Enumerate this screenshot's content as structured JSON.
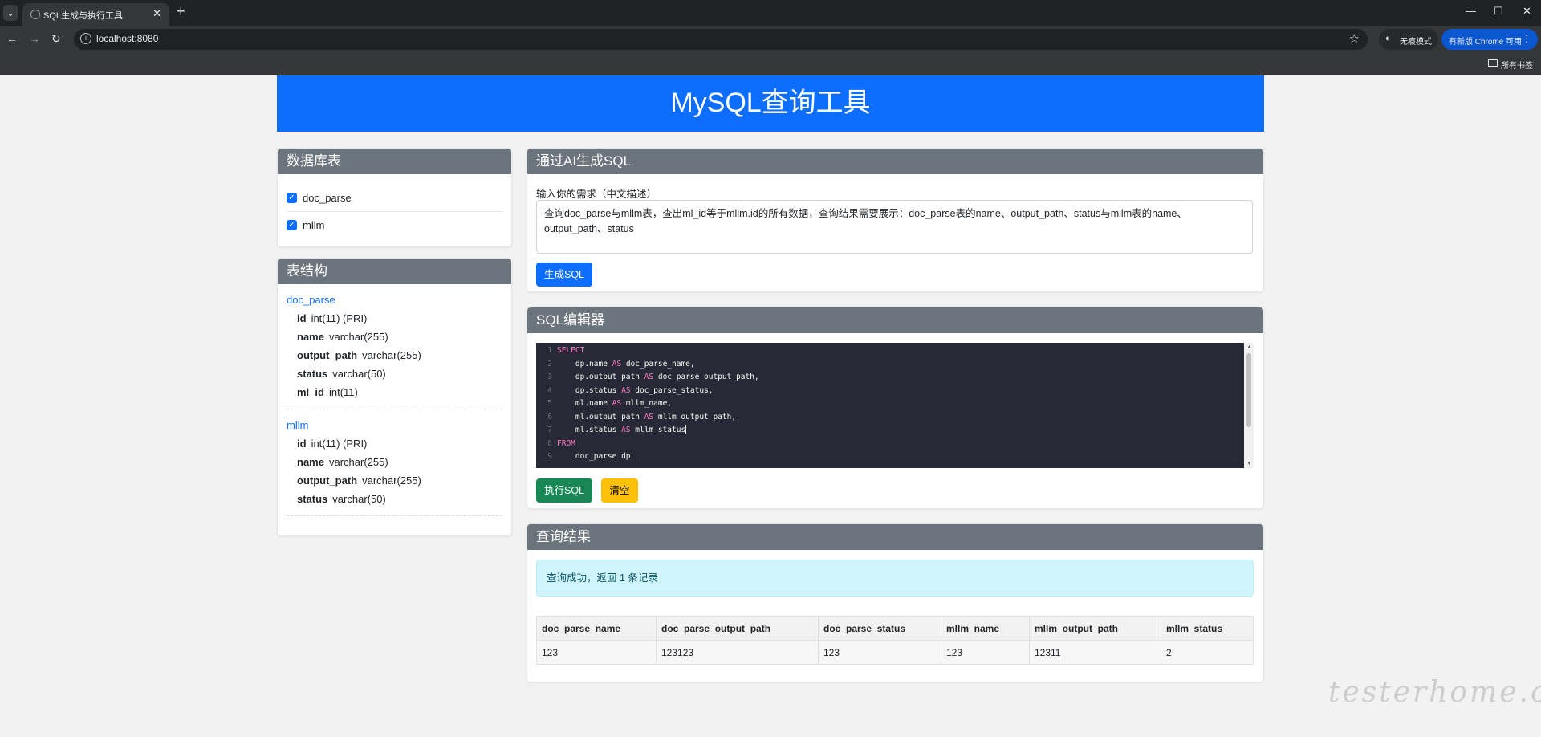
{
  "browser": {
    "tab_title": "SQL生成与执行工具",
    "url": "localhost:8080",
    "incognito_label": "无痕模式",
    "update_label": "有新版 Chrome 可用",
    "bookmarks_label": "所有书签"
  },
  "header": {
    "title": "MySQL查询工具"
  },
  "tables_panel": {
    "title": "数据库表",
    "tables": [
      {
        "name": "doc_parse",
        "checked": true
      },
      {
        "name": "mllm",
        "checked": true
      }
    ]
  },
  "schema_panel": {
    "title": "表结构",
    "tables": [
      {
        "name": "doc_parse",
        "columns": [
          {
            "name": "id",
            "type": "int(11) (PRI)"
          },
          {
            "name": "name",
            "type": "varchar(255)"
          },
          {
            "name": "output_path",
            "type": "varchar(255)"
          },
          {
            "name": "status",
            "type": "varchar(50)"
          },
          {
            "name": "ml_id",
            "type": "int(11)"
          }
        ]
      },
      {
        "name": "mllm",
        "columns": [
          {
            "name": "id",
            "type": "int(11) (PRI)"
          },
          {
            "name": "name",
            "type": "varchar(255)"
          },
          {
            "name": "output_path",
            "type": "varchar(255)"
          },
          {
            "name": "status",
            "type": "varchar(50)"
          }
        ]
      }
    ]
  },
  "ai_panel": {
    "title": "通过AI生成SQL",
    "input_label": "输入你的需求（中文描述）",
    "input_value": "查询doc_parse与mllm表，查出ml_id等于mllm.id的所有数据，查询结果需要展示：doc_parse表的name、output_path、status与mllm表的name、output_path、status",
    "generate_button": "生成SQL"
  },
  "editor_panel": {
    "title": "SQL编辑器",
    "lines": [
      {
        "n": "1",
        "kw": "SELECT",
        "text": ""
      },
      {
        "n": "2",
        "text": "    dp.name ",
        "kw2": "AS",
        "text2": " doc_parse_name,"
      },
      {
        "n": "3",
        "text": "    dp.output_path ",
        "kw2": "AS",
        "text2": " doc_parse_output_path,"
      },
      {
        "n": "4",
        "text": "    dp.status ",
        "kw2": "AS",
        "text2": " doc_parse_status,"
      },
      {
        "n": "5",
        "text": "    ml.name ",
        "kw2": "AS",
        "text2": " mllm_name,"
      },
      {
        "n": "6",
        "text": "    ml.output_path ",
        "kw2": "AS",
        "text2": " mllm_output_path,"
      },
      {
        "n": "7",
        "text": "    ml.status ",
        "kw2": "AS",
        "text2": " mllm_status"
      },
      {
        "n": "8",
        "kw": "FROM",
        "text": ""
      },
      {
        "n": "9",
        "text": "    doc_parse dp"
      }
    ],
    "execute_button": "执行SQL",
    "clear_button": "清空"
  },
  "results_panel": {
    "title": "查询结果",
    "alert": "查询成功，返回 1 条记录",
    "columns": [
      "doc_parse_name",
      "doc_parse_output_path",
      "doc_parse_status",
      "mllm_name",
      "mllm_output_path",
      "mllm_status"
    ],
    "rows": [
      [
        "123",
        "123123",
        "123",
        "123",
        "12311",
        "2"
      ]
    ]
  },
  "watermark": "testerhome.com",
  "colors": {
    "primary": "#0d6efd",
    "card_header": "#6c757d",
    "success": "#198754",
    "warning": "#ffc107",
    "alert_bg": "#cff4fc"
  }
}
